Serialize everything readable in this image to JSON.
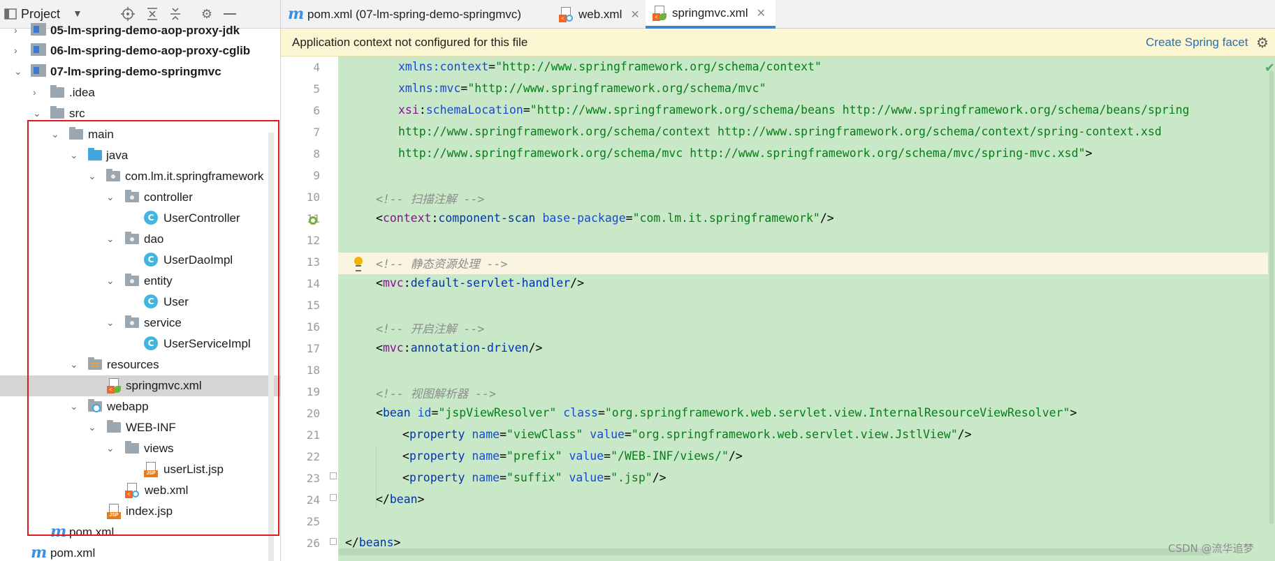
{
  "project_panel": {
    "title": "Project",
    "dropdown": "▼",
    "tree": [
      {
        "label": "05-lm-spring-demo-aop-proxy-jdk",
        "bold": true
      },
      {
        "label": "06-lm-spring-demo-aop-proxy-cglib",
        "bold": true
      },
      {
        "label": "07-lm-spring-demo-springmvc",
        "bold": true
      },
      {
        "label": ".idea"
      },
      {
        "label": "src"
      },
      {
        "label": "main"
      },
      {
        "label": "java"
      },
      {
        "label": "com.lm.it.springframework"
      },
      {
        "label": "controller"
      },
      {
        "label": "UserController"
      },
      {
        "label": "dao"
      },
      {
        "label": "UserDaoImpl"
      },
      {
        "label": "entity"
      },
      {
        "label": "User"
      },
      {
        "label": "service"
      },
      {
        "label": "UserServiceImpl"
      },
      {
        "label": "resources"
      },
      {
        "label": "springmvc.xml"
      },
      {
        "label": "webapp"
      },
      {
        "label": "WEB-INF"
      },
      {
        "label": "views"
      },
      {
        "label": "userList.jsp"
      },
      {
        "label": "web.xml"
      },
      {
        "label": "index.jsp"
      },
      {
        "label": "pom.xml"
      },
      {
        "label": "pom.xml"
      }
    ]
  },
  "tabs": [
    {
      "label": "pom.xml (07-lm-spring-demo-springmvc)"
    },
    {
      "label": "web.xml"
    },
    {
      "label": "springmvc.xml",
      "active": true
    }
  ],
  "banner": {
    "message": "Application context not configured for this file",
    "action": "Create Spring facet"
  },
  "editor": {
    "line_numbers": [
      "4",
      "5",
      "6",
      "7",
      "8",
      "9",
      "10",
      "11",
      "12",
      "13",
      "14",
      "15",
      "16",
      "17",
      "18",
      "19",
      "20",
      "21",
      "22",
      "23",
      "24",
      "25",
      "26"
    ],
    "lines": {
      "l4_ns": "xmlns",
      "l4_name": "context",
      "l4_val": "\"http://www.springframework.org/schema/context\"",
      "l5_ns": "xmlns",
      "l5_name": "mvc",
      "l5_val": "\"http://www.springframework.org/schema/mvc\"",
      "l6_ns": "xsi",
      "l6_name": "schemaLocation",
      "l6_val": "\"http://www.springframework.org/schema/beans http://www.springframework.org/schema/beans/spring",
      "l7": "http://www.springframework.org/schema/context http://www.springframework.org/schema/context/spring-context.xsd",
      "l8_val": "http://www.springframework.org/schema/mvc http://www.springframework.org/schema/mvc/spring-mvc.xsd\"",
      "l8_end": ">",
      "l10": "<!-- 扫描注解 -->",
      "l11_ns": "context",
      "l11_tag": "component-scan",
      "l11_attr": "base-package",
      "l11_val": "\"com.lm.it.springframework\"",
      "l13": "<!-- 静态资源处理 -->",
      "l14_ns": "mvc",
      "l14_tag": "default-servlet-handler",
      "l16": "<!-- 开启注解 -->",
      "l17_ns": "mvc",
      "l17_tag": "annotation-driven",
      "l19": "<!-- 视图解析器 -->",
      "l20_tag": "bean",
      "l20_a1": "id",
      "l20_v1": "\"jspViewResolver\"",
      "l20_a2": "class",
      "l20_v2": "\"org.springframework.web.servlet.view.InternalResourceViewResolver\"",
      "prop_tag": "property",
      "name_attr": "name",
      "value_attr": "value",
      "l21_n": "\"viewClass\"",
      "l21_v": "\"org.springframework.web.servlet.view.JstlView\"",
      "l22_n": "\"prefix\"",
      "l22_v": "\"/WEB-INF/views/\"",
      "l23_n": "\"suffix\"",
      "l23_v": "\".jsp\"",
      "l24_tag": "bean",
      "l26_tag": "beans"
    }
  },
  "watermark": "CSDN @流华追梦",
  "colors": {
    "editor_bg": "#c8e8c8",
    "highlight_box": "#e0191a",
    "banner_bg": "#fdf6d3",
    "link": "#2470b3"
  }
}
